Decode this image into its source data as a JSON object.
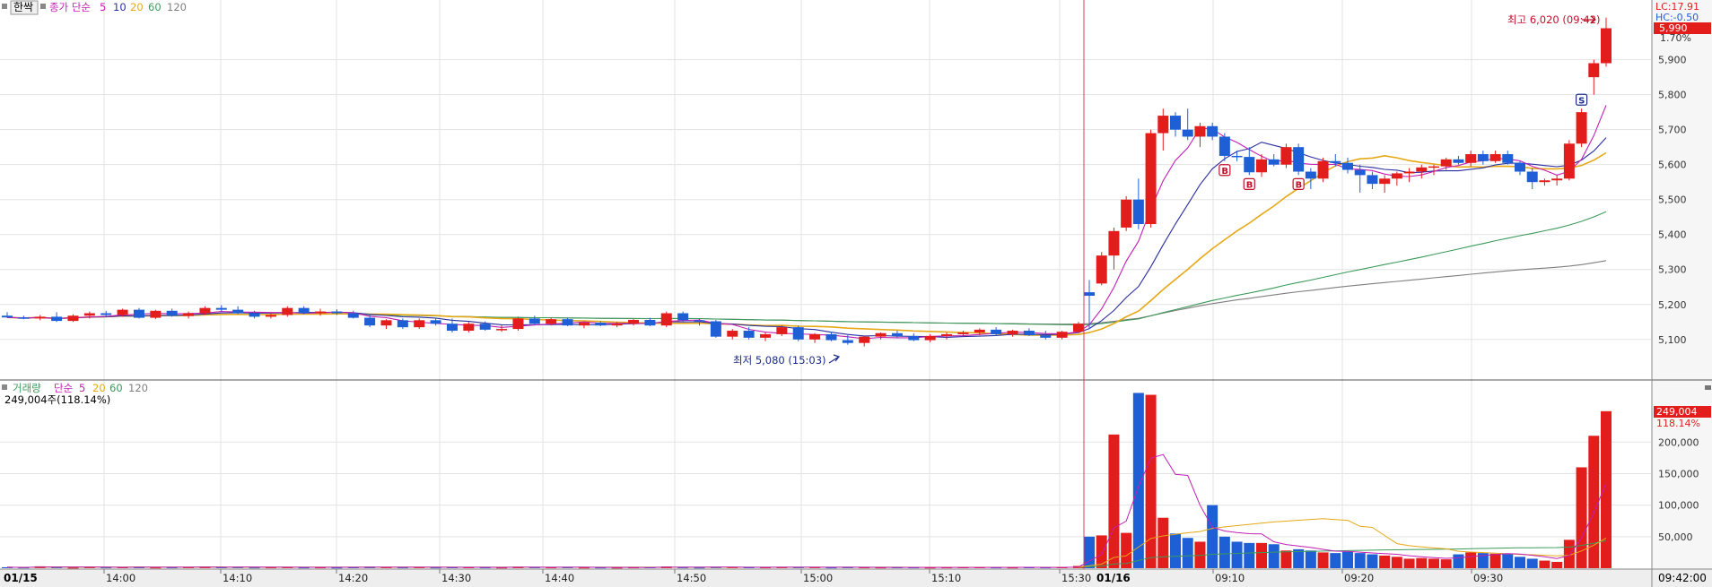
{
  "legend": {
    "price_title": "한싹",
    "price_ma_label": "종가 단순",
    "ma_periods": [
      "5",
      "10",
      "20",
      "60",
      "120"
    ],
    "volume_title": "거래량",
    "volume_ma_label": "단순",
    "volume_ma_periods": [
      "5",
      "20",
      "60",
      "120"
    ],
    "volume_now": "249,004주(118.14%)"
  },
  "header_right": {
    "lc": "LC:17.91",
    "hc": "HC:-0.50",
    "pct_label": "1.70%"
  },
  "annotations": {
    "high": "최고 6,020 (09:42)",
    "low": "최저 5,080 (15:03)",
    "buy_marker": "B",
    "sell_marker": "S"
  },
  "tags": {
    "current_price": "5,990",
    "current_volume": "249,004",
    "current_volume_pct": "118.14%"
  },
  "x_axis": {
    "start_date": "01/15",
    "end_date": "01/16",
    "end_time": "09:42:00",
    "ticks": [
      "14:00",
      "14:10",
      "14:20",
      "14:30",
      "14:40",
      "14:50",
      "15:00",
      "15:10",
      "15:30",
      "09:10",
      "09:20",
      "09:30"
    ]
  },
  "colors": {
    "up": "#e31c1c",
    "down": "#1f5fd6",
    "ma5": "#c21fb4",
    "ma10": "#2a2ea0",
    "ma20": "#e6a817",
    "ma60": "#3c9a5a",
    "ma120": "#7f7f7f"
  },
  "chart_data": {
    "type": "candlestick",
    "title": "한싹",
    "interval": "1 minute",
    "y_price_ticks": [
      5100,
      5200,
      5300,
      5400,
      5500,
      5600,
      5700,
      5800,
      5900
    ],
    "y_price_range": [
      5020,
      6040
    ],
    "y_volume_ticks": [
      50000,
      100000,
      150000,
      200000
    ],
    "y_volume_range": [
      0,
      290000
    ],
    "high": {
      "value": 6020,
      "time": "09:42"
    },
    "low": {
      "value": 5080,
      "time": "15:03"
    },
    "last": {
      "close": 5990,
      "volume": 249004,
      "volume_pct": 118.14
    },
    "day1_candles": [
      [
        5168,
        5178,
        5162,
        5163
      ],
      [
        5163,
        5168,
        5158,
        5160
      ],
      [
        5160,
        5170,
        5155,
        5165
      ],
      [
        5165,
        5178,
        5150,
        5153
      ],
      [
        5153,
        5172,
        5150,
        5168
      ],
      [
        5168,
        5180,
        5160,
        5175
      ],
      [
        5175,
        5182,
        5165,
        5170
      ],
      [
        5170,
        5188,
        5165,
        5185
      ],
      [
        5185,
        5190,
        5160,
        5162
      ],
      [
        5162,
        5185,
        5158,
        5182
      ],
      [
        5182,
        5188,
        5165,
        5167
      ],
      [
        5167,
        5180,
        5160,
        5175
      ],
      [
        5175,
        5195,
        5170,
        5190
      ],
      [
        5190,
        5198,
        5180,
        5185
      ],
      [
        5185,
        5195,
        5172,
        5175
      ],
      [
        5175,
        5182,
        5160,
        5165
      ],
      [
        5165,
        5175,
        5160,
        5170
      ],
      [
        5170,
        5195,
        5165,
        5190
      ],
      [
        5190,
        5195,
        5172,
        5175
      ],
      [
        5175,
        5188,
        5168,
        5180
      ],
      [
        5180,
        5186,
        5170,
        5175
      ],
      [
        5175,
        5182,
        5160,
        5162
      ],
      [
        5162,
        5170,
        5135,
        5140
      ],
      [
        5140,
        5158,
        5130,
        5155
      ],
      [
        5155,
        5160,
        5130,
        5135
      ],
      [
        5135,
        5160,
        5130,
        5155
      ],
      [
        5155,
        5162,
        5140,
        5145
      ],
      [
        5145,
        5160,
        5120,
        5125
      ],
      [
        5125,
        5150,
        5120,
        5145
      ],
      [
        5145,
        5152,
        5125,
        5128
      ],
      [
        5128,
        5140,
        5122,
        5130
      ],
      [
        5130,
        5165,
        5125,
        5160
      ],
      [
        5160,
        5168,
        5140,
        5145
      ],
      [
        5145,
        5162,
        5140,
        5158
      ],
      [
        5158,
        5162,
        5138,
        5140
      ],
      [
        5140,
        5152,
        5132,
        5148
      ],
      [
        5148,
        5152,
        5138,
        5140
      ],
      [
        5140,
        5150,
        5135,
        5145
      ],
      [
        5145,
        5158,
        5140,
        5156
      ],
      [
        5156,
        5162,
        5138,
        5140
      ],
      [
        5140,
        5180,
        5135,
        5175
      ],
      [
        5175,
        5180,
        5150,
        5155
      ],
      [
        5155,
        5160,
        5140,
        5152
      ],
      [
        5152,
        5156,
        5105,
        5108
      ],
      [
        5108,
        5130,
        5100,
        5125
      ],
      [
        5125,
        5135,
        5100,
        5105
      ],
      [
        5105,
        5120,
        5095,
        5115
      ],
      [
        5115,
        5140,
        5110,
        5135
      ],
      [
        5135,
        5140,
        5095,
        5100
      ],
      [
        5100,
        5118,
        5090,
        5115
      ],
      [
        5115,
        5122,
        5095,
        5098
      ],
      [
        5098,
        5112,
        5085,
        5090
      ],
      [
        5090,
        5110,
        5080,
        5108
      ],
      [
        5108,
        5120,
        5100,
        5118
      ],
      [
        5118,
        5125,
        5105,
        5110
      ],
      [
        5110,
        5118,
        5095,
        5098
      ],
      [
        5098,
        5115,
        5092,
        5110
      ],
      [
        5110,
        5120,
        5100,
        5115
      ],
      [
        5115,
        5125,
        5108,
        5120
      ],
      [
        5120,
        5132,
        5112,
        5128
      ],
      [
        5128,
        5135,
        5110,
        5115
      ],
      [
        5115,
        5128,
        5108,
        5125
      ],
      [
        5125,
        5132,
        5110,
        5112
      ],
      [
        5112,
        5125,
        5100,
        5105
      ],
      [
        5105,
        5125,
        5100,
        5122
      ],
      [
        5122,
        5150,
        5118,
        5145
      ]
    ],
    "day2_candles": [
      [
        5235,
        5270,
        5130,
        5225
      ],
      [
        5260,
        5350,
        5255,
        5340
      ],
      [
        5340,
        5420,
        5300,
        5410
      ],
      [
        5420,
        5510,
        5410,
        5500
      ],
      [
        5500,
        5560,
        5415,
        5430
      ],
      [
        5430,
        5700,
        5420,
        5690
      ],
      [
        5690,
        5760,
        5640,
        5740
      ],
      [
        5740,
        5750,
        5680,
        5700
      ],
      [
        5700,
        5760,
        5670,
        5680
      ],
      [
        5680,
        5720,
        5650,
        5710
      ],
      [
        5710,
        5720,
        5670,
        5680
      ],
      [
        5680,
        5690,
        5610,
        5625
      ],
      [
        5625,
        5640,
        5610,
        5622
      ],
      [
        5622,
        5650,
        5570,
        5578
      ],
      [
        5578,
        5630,
        5565,
        5615
      ],
      [
        5615,
        5630,
        5595,
        5600
      ],
      [
        5600,
        5660,
        5590,
        5650
      ],
      [
        5650,
        5660,
        5570,
        5580
      ],
      [
        5580,
        5590,
        5530,
        5560
      ],
      [
        5560,
        5620,
        5550,
        5610
      ],
      [
        5610,
        5630,
        5595,
        5605
      ],
      [
        5605,
        5620,
        5575,
        5585
      ],
      [
        5585,
        5600,
        5520,
        5570
      ],
      [
        5570,
        5580,
        5530,
        5545
      ],
      [
        5545,
        5570,
        5520,
        5560
      ],
      [
        5560,
        5580,
        5540,
        5575
      ],
      [
        5575,
        5590,
        5550,
        5580
      ],
      [
        5580,
        5600,
        5560,
        5592
      ],
      [
        5592,
        5600,
        5570,
        5595
      ],
      [
        5595,
        5620,
        5585,
        5615
      ],
      [
        5615,
        5625,
        5600,
        5605
      ],
      [
        5605,
        5640,
        5595,
        5630
      ],
      [
        5630,
        5640,
        5600,
        5610
      ],
      [
        5610,
        5640,
        5605,
        5630
      ],
      [
        5630,
        5640,
        5600,
        5605
      ],
      [
        5605,
        5610,
        5570,
        5580
      ],
      [
        5580,
        5590,
        5530,
        5550
      ],
      [
        5550,
        5560,
        5540,
        5555
      ],
      [
        5555,
        5570,
        5540,
        5560
      ],
      [
        5560,
        5670,
        5555,
        5660
      ],
      [
        5660,
        5760,
        5650,
        5750
      ],
      [
        5850,
        5900,
        5800,
        5890
      ],
      [
        5890,
        6020,
        5880,
        5990
      ]
    ],
    "day1_volumes": [
      1500,
      1200,
      3000,
      1800,
      900,
      1500,
      1300,
      1700,
      2200,
      1100,
      1300,
      1500,
      2500,
      1400,
      1600,
      1200,
      1300,
      2000,
      1200,
      1300,
      1100,
      1500,
      2400,
      1400,
      1300,
      1500,
      1200,
      1600,
      1400,
      1300,
      1100,
      2300,
      1400,
      1300,
      1500,
      1100,
      1200,
      1000,
      1300,
      1400,
      2600,
      1300,
      1100,
      1800,
      1400,
      1500,
      1300,
      1600,
      1800,
      1400,
      1200,
      1500,
      1300,
      1200,
      1400,
      1300,
      1100,
      1300,
      1400,
      1500,
      1300,
      1200,
      1400,
      1300,
      1500,
      3500
    ],
    "day2_volumes": [
      50000,
      52000,
      212000,
      56000,
      278000,
      275000,
      80000,
      55000,
      48000,
      42000,
      100000,
      50000,
      42000,
      40000,
      40000,
      38000,
      28000,
      30000,
      28000,
      25000,
      24000,
      26000,
      24000,
      22000,
      20000,
      18000,
      15000,
      16000,
      15000,
      14000,
      22000,
      25000,
      24000,
      23000,
      22000,
      18000,
      15000,
      12000,
      10000,
      45000,
      160000,
      210000,
      249004
    ],
    "signals": [
      {
        "type": "B",
        "day": 2,
        "index": 11
      },
      {
        "type": "B",
        "day": 2,
        "index": 13
      },
      {
        "type": "B",
        "day": 2,
        "index": 17
      },
      {
        "type": "S",
        "day": 2,
        "index": 40
      }
    ]
  }
}
